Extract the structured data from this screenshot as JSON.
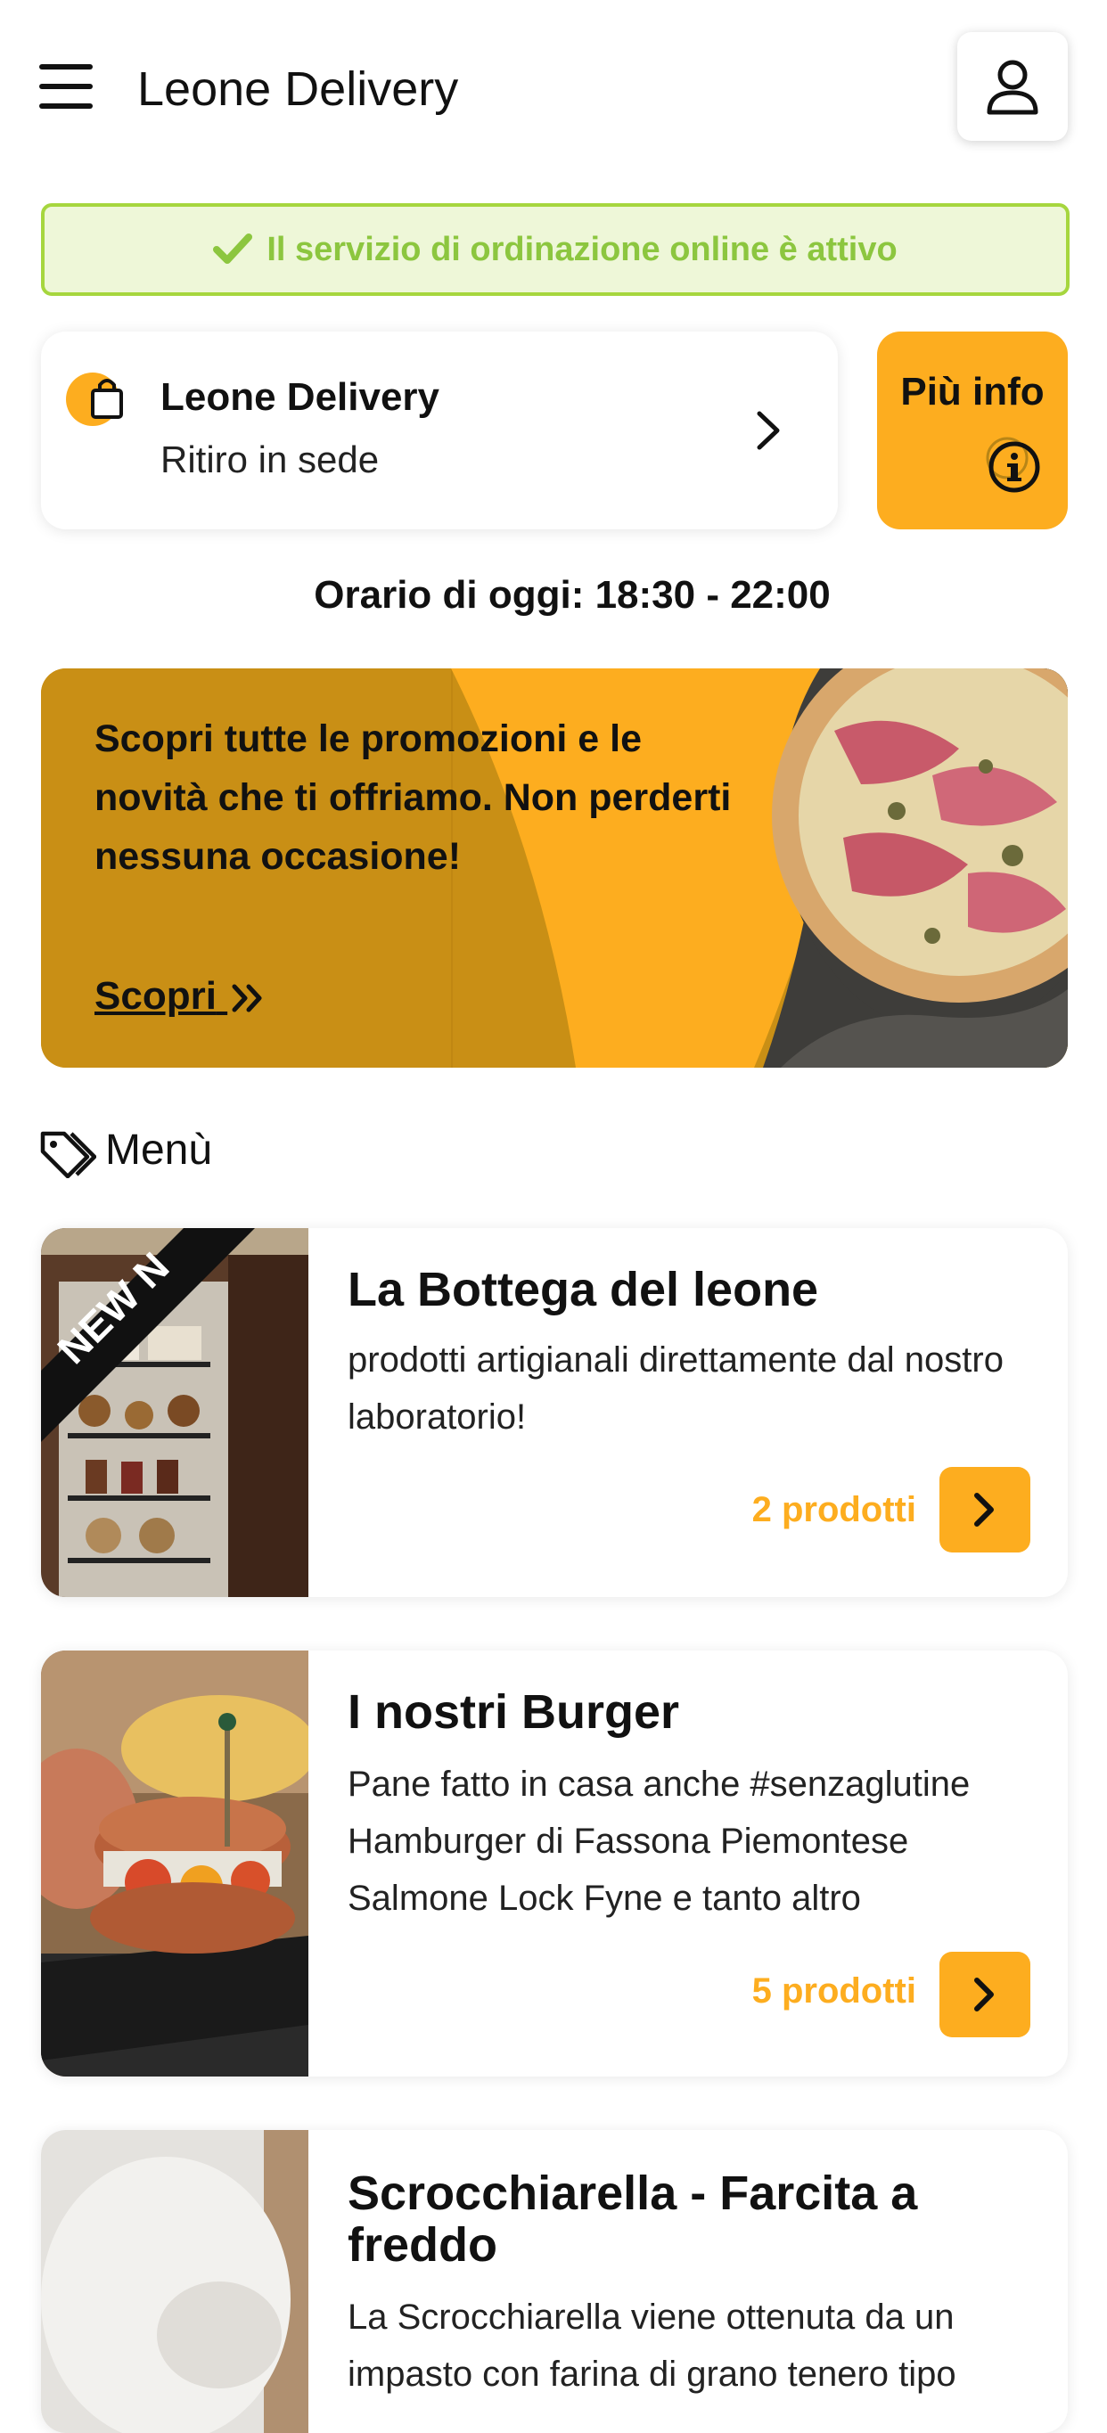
{
  "header": {
    "title": "Leone Delivery",
    "menu_icon": "hamburger-icon",
    "profile_icon": "user-icon"
  },
  "status": {
    "text": "Il servizio di ordinazione online è attivo",
    "icon": "check-icon",
    "color": "#8cc63f"
  },
  "store": {
    "name": "Leone Delivery",
    "mode": "Ritiro in sede",
    "icon": "shopping-bag-icon"
  },
  "info_button": {
    "label": "Più info",
    "icon": "info-icon"
  },
  "hours": {
    "text": "Orario di oggi: 18:30 - 22:00"
  },
  "promo": {
    "text": "Scopri tutte le promozioni e le novità che ti offriamo. Non perderti nessuna occasione!",
    "link_label": "Scopri",
    "link_icon": "double-chevron-right-icon"
  },
  "menu": {
    "heading": "Menù",
    "heading_icon": "tags-icon",
    "categories": [
      {
        "title": "La Bottega del leone",
        "description": "prodotti artigianali direttamente dal nostro laboratorio!",
        "count": "2 prodotti",
        "badge": "NEW"
      },
      {
        "title": "I nostri Burger",
        "description": "Pane fatto in casa anche #senzaglutine Hamburger di Fassona Piemontese Salmone Lock Fyne e tanto altro",
        "count": "5 prodotti"
      },
      {
        "title": "Scrocchiarella - Farcita a freddo",
        "description": "La Scrocchiarella viene ottenuta da un impasto con farina di grano tenero tipo"
      }
    ]
  },
  "colors": {
    "accent": "#fdad1f",
    "promo_dark": "#c98f15",
    "status_bg": "#eef7d8",
    "status_border": "#a6d63e"
  }
}
